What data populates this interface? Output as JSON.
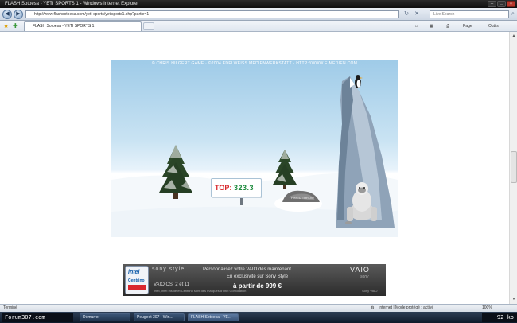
{
  "window": {
    "title": "FLASH Sotoesa - YETI SPORTS 1 - Windows Internet Explorer"
  },
  "address": {
    "url": "http://www.flashsotoesa.com/yeti-sports/yetisports1.php?partie=1",
    "search_placeholder": "Live Search"
  },
  "tab": {
    "label": "FLASH Sotoesa - YETI SPORTS 1"
  },
  "commands": {
    "home": "⌂",
    "feeds": "▦",
    "print": "⎙",
    "page": "Page",
    "tools": "Outils"
  },
  "game": {
    "credits": "© CHRIS HILGERT GAME · ©2004 EDELWEISS MEDIENWERKSTATT · HTTP://WWW.E-MEDIEN.COM",
    "top_label": "TOP:",
    "top_score": "323.3",
    "sign_text": "PINGU THROW"
  },
  "ad": {
    "intel_line1": "intel",
    "intel_line2": "Centrino",
    "brand": "sony style",
    "headline1": "Personnalisez votre VAIO dès maintenant",
    "headline2": "En exclusivité sur Sony Style",
    "price": "à partir de 999 €",
    "vaio": "VAIO",
    "vaio_sub": "sony",
    "model": "VAIO CS, 2 et 11",
    "fineprint": "Intel, Intel Inside et Centrino sont des marques d'Intel Corporation",
    "small_right": "Sony VAIO"
  },
  "status": {
    "left": "Terminé",
    "zone": "Internet | Mode protégé : activé",
    "zoom": "100%"
  },
  "taskbar": {
    "start": "Forum307.com",
    "tasks": [
      "Démarrer",
      "Peugeot 307 - Win...",
      "FLASH Sotoesa - YE..."
    ],
    "tray": "92 ko"
  }
}
